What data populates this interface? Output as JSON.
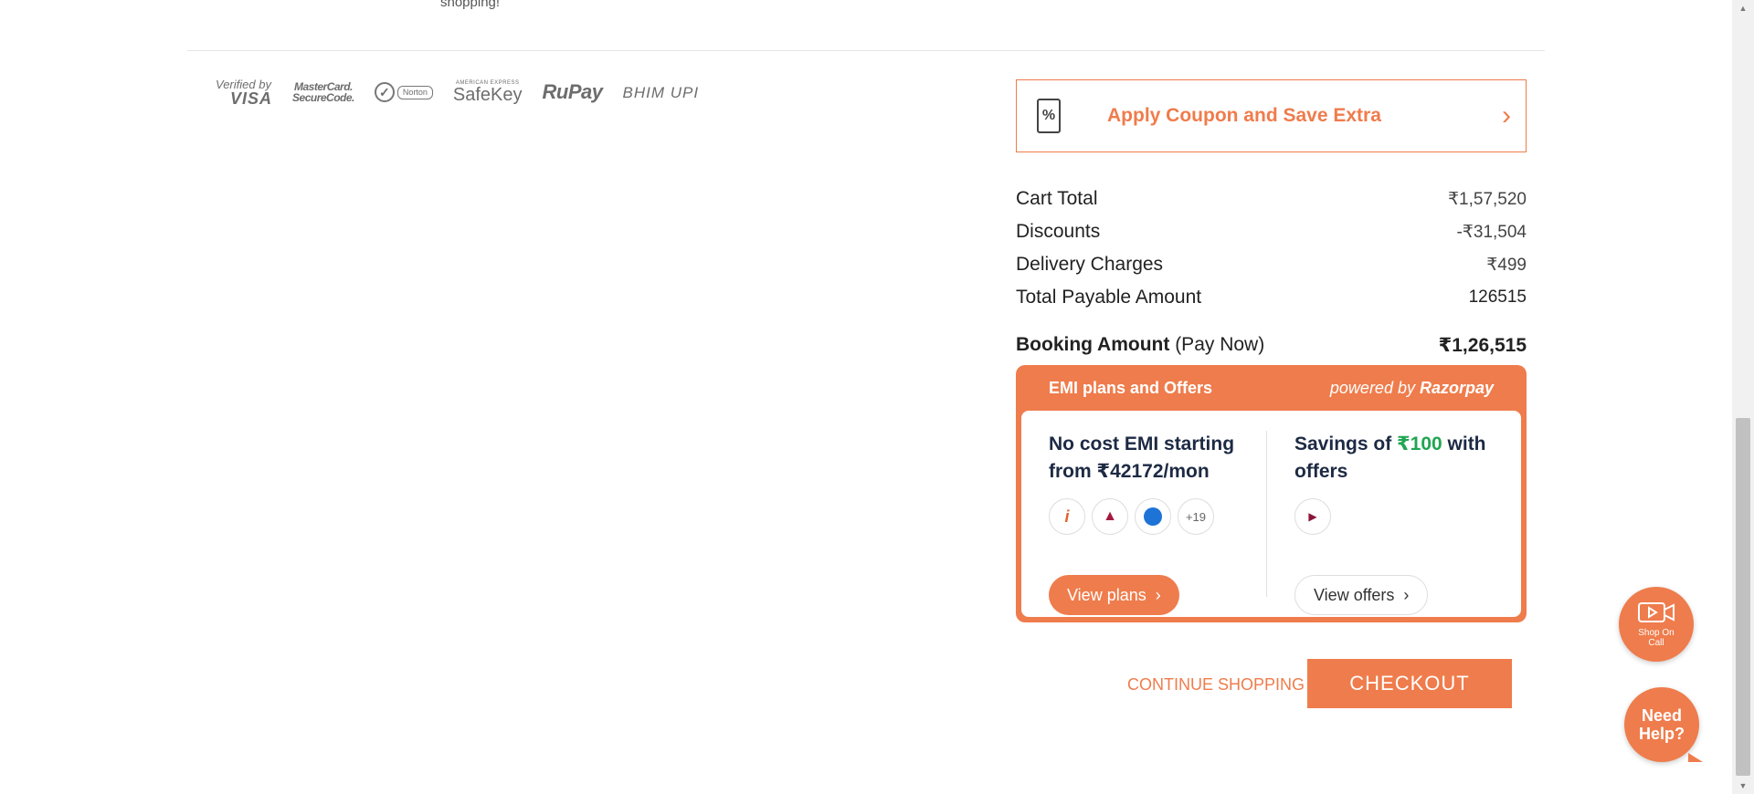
{
  "top_fragment": "shopping!",
  "payment_logos": {
    "visa_a": "Verified by",
    "visa_b": "VISA",
    "mc_a": "MasterCard.",
    "mc_b": "SecureCode.",
    "norton": "Norton",
    "safekey_a": "AMERICAN EXPRESS",
    "safekey_b": "SafeKey",
    "rupay": "RuPay",
    "bhim": "BHIM UPI"
  },
  "coupon": {
    "label": "Apply Coupon and Save Extra"
  },
  "summary": {
    "rows": [
      {
        "label": "Cart Total",
        "value": "₹1,57,520"
      },
      {
        "label": "Discounts",
        "value": "-₹31,504"
      },
      {
        "label": "Delivery Charges",
        "value": "₹499"
      },
      {
        "label": "Total Payable Amount",
        "value": "126515"
      }
    ]
  },
  "booking": {
    "label": "Booking Amount",
    "label_suffix": " (Pay Now)",
    "value": "₹1,26,515"
  },
  "emi": {
    "title": "EMI plans and Offers",
    "powered_prefix": "powered by ",
    "powered_brand": "Razorpay",
    "left_heading": "No cost EMI starting from ₹42172/mon",
    "banks_more": "+19",
    "view_plans": "View plans",
    "right_heading_a": "Savings of ",
    "right_heading_amount": "₹100",
    "right_heading_b": " with offers",
    "view_offers": "View offers"
  },
  "actions": {
    "continue": "CONTINUE SHOPPING",
    "checkout": "CHECKOUT"
  },
  "floating": {
    "shop_on_call": "Shop On Call",
    "need_help_a": "Need",
    "need_help_b": "Help?"
  },
  "colors": {
    "accent": "#ef7c4c",
    "green": "#20a551",
    "navy": "#1d2a44"
  }
}
